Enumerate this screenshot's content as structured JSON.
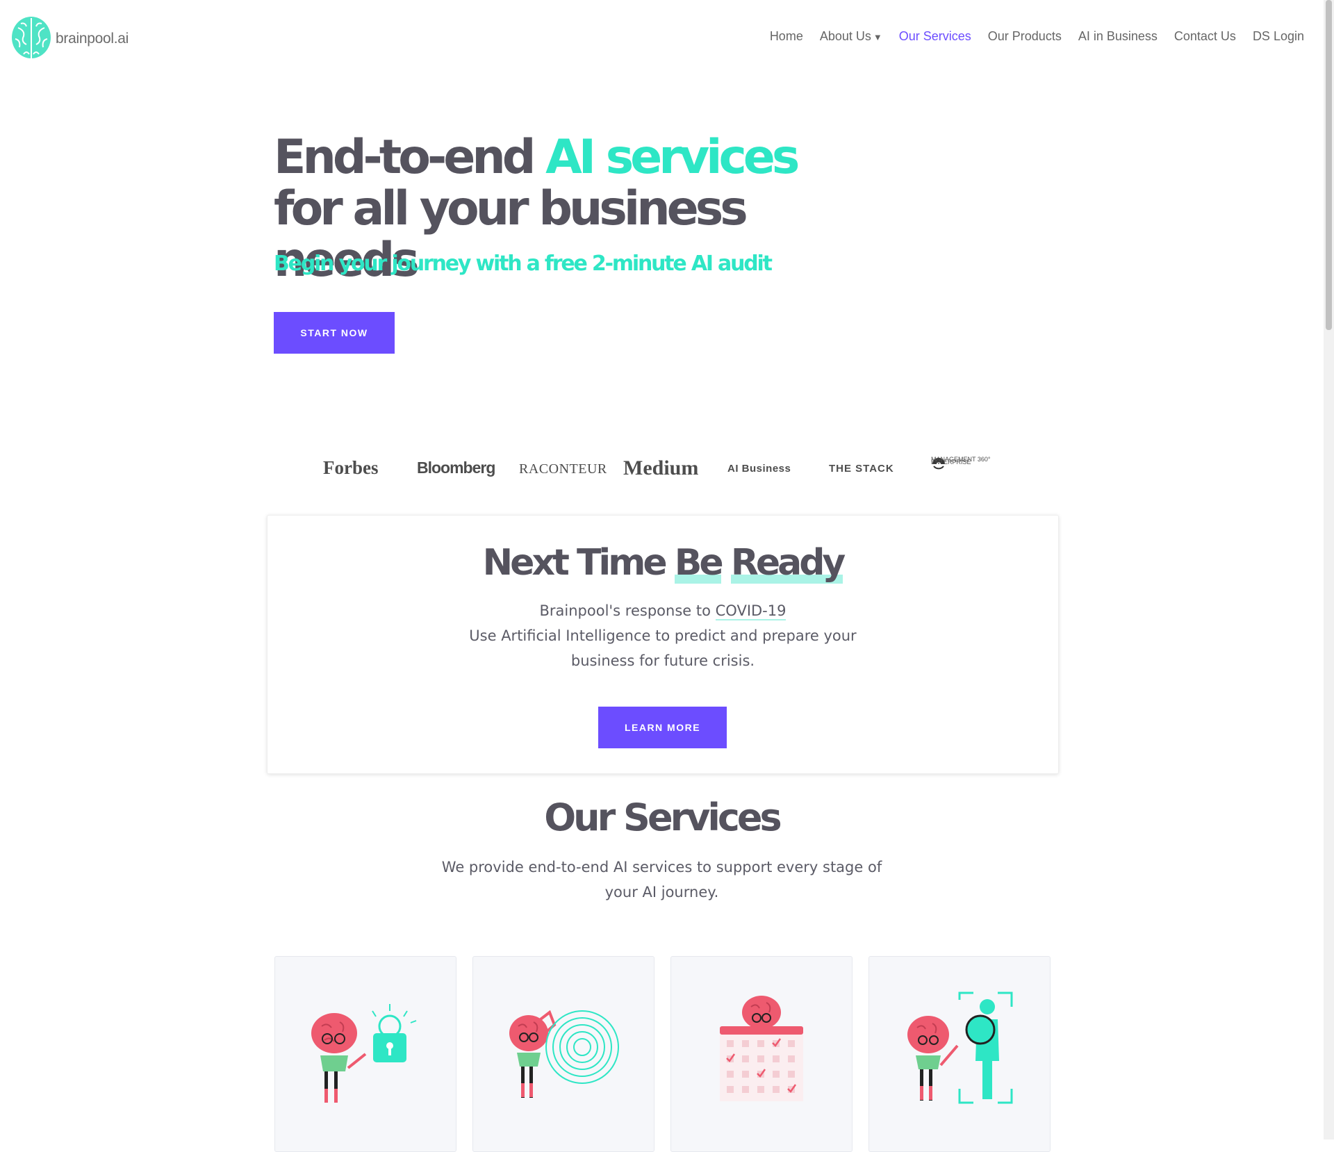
{
  "header": {
    "logo_text": "brainpool.ai",
    "nav": {
      "home": "Home",
      "about": "About Us",
      "services": "Our Services",
      "products": "Our Products",
      "ai_business": "AI in Business",
      "contact": "Contact Us",
      "ds_login": "DS Login"
    }
  },
  "hero": {
    "title_part1": "End-to-end ",
    "title_accent": "AI services",
    "title_part2": " for all your business needs",
    "subtitle": "Begin your journey with a free 2-minute AI audit",
    "cta": "START NOW"
  },
  "press": {
    "forbes": "Forbes",
    "bloomberg": "Bloomberg",
    "raconteur": "RACONTEUR",
    "medium": "Medium",
    "ai_business": "AI Business",
    "the_stack": "THE STACK",
    "enterprise_line1": "ENTERPRISE",
    "enterprise_line2": "MANAGEMENT 360°"
  },
  "covid": {
    "title_part1": "Next Time ",
    "title_be": "Be",
    "title_ready": "Ready",
    "line1_prefix": "Brainpool's response to ",
    "line1_link": "COVID-19",
    "line2": "Use Artificial Intelligence to predict and prepare your business for future crisis.",
    "cta": "LEARN MORE"
  },
  "services": {
    "title": "Our Services",
    "description": "We provide end-to-end AI services to support every stage of your AI journey."
  },
  "colors": {
    "accent_teal": "#2ee6c5",
    "brand_purple": "#6c4dff",
    "heading_gray": "#55535e",
    "brain_pink": "#ee5a6f"
  }
}
